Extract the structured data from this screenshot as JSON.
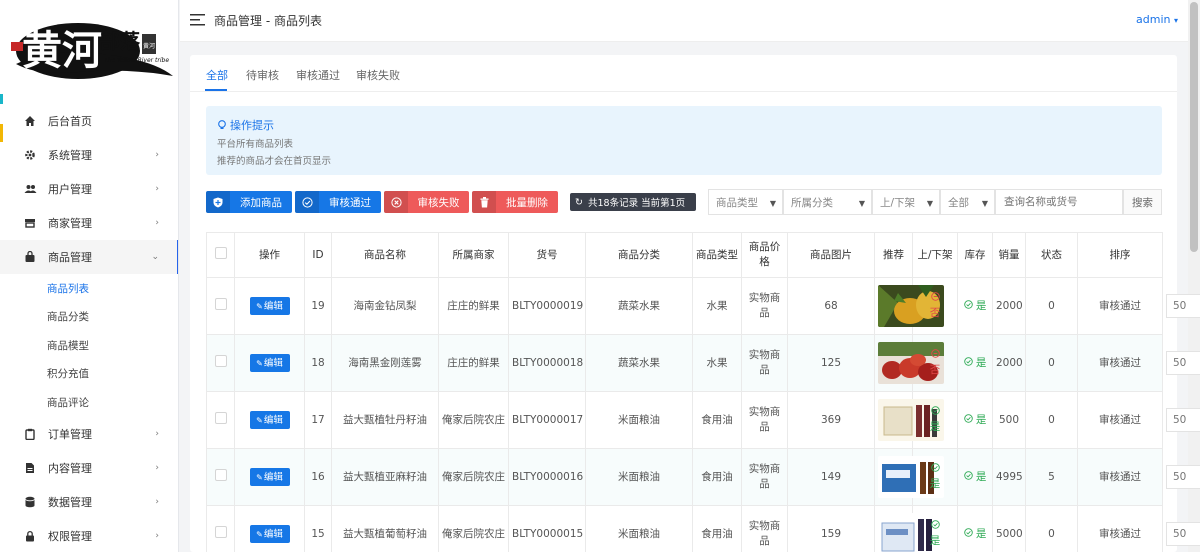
{
  "brand": {
    "logo_text": "黄河部落",
    "logo_sub": "The Yellow River tribe",
    "logo_seal": "黄河"
  },
  "header": {
    "breadcrumb": "商品管理 - 商品列表",
    "user": "admin"
  },
  "sidebar": {
    "items": [
      {
        "label": "后台首页",
        "icon": "home-icon"
      },
      {
        "label": "系统管理",
        "icon": "gear-icon"
      },
      {
        "label": "用户管理",
        "icon": "users-icon"
      },
      {
        "label": "商家管理",
        "icon": "store-icon"
      },
      {
        "label": "商品管理",
        "icon": "bag-icon"
      },
      {
        "label": "订单管理",
        "icon": "clipboard-icon"
      },
      {
        "label": "内容管理",
        "icon": "file-icon"
      },
      {
        "label": "数据管理",
        "icon": "database-icon"
      },
      {
        "label": "权限管理",
        "icon": "lock-icon"
      }
    ],
    "sub_items": [
      {
        "label": "商品列表"
      },
      {
        "label": "商品分类"
      },
      {
        "label": "商品模型"
      },
      {
        "label": "积分充值"
      },
      {
        "label": "商品评论"
      }
    ]
  },
  "tabs": [
    {
      "label": "全部"
    },
    {
      "label": "待审核"
    },
    {
      "label": "审核通过"
    },
    {
      "label": "审核失败"
    }
  ],
  "tip": {
    "title": "操作提示",
    "lines": [
      "平台所有商品列表",
      "推荐的商品才会在首页显示"
    ]
  },
  "toolbar": {
    "add": "添加商品",
    "approve": "审核通过",
    "reject": "审核失败",
    "batch_delete": "批量删除",
    "stat": "共18条记录 当前第1页",
    "filters": [
      "商品类型",
      "所属分类",
      "上/下架",
      "全部"
    ],
    "search_placeholder": "查询名称或货号",
    "search": "搜索"
  },
  "table": {
    "columns": [
      "操作",
      "ID",
      "商品名称",
      "所属商家",
      "货号",
      "商品分类",
      "商品类型",
      "商品价格",
      "商品图片",
      "推荐",
      "上/下架",
      "库存",
      "销量",
      "状态",
      "排序"
    ],
    "edit_label": "编辑",
    "rows": [
      {
        "id": "19",
        "name": "海南金钻凤梨",
        "merchant": "庄庄的鲜果",
        "sku": "BLTY0000019",
        "cat1": "蔬菜水果",
        "cat2": "水果",
        "type": "实物商品",
        "price": "68",
        "img": "pineapple",
        "recommend": "否",
        "shelf": "是",
        "stock": "2000",
        "sales": "0",
        "status": "审核通过",
        "sort": "50"
      },
      {
        "id": "18",
        "name": "海南黑金刚莲雾",
        "merchant": "庄庄的鲜果",
        "sku": "BLTY0000018",
        "cat1": "蔬菜水果",
        "cat2": "水果",
        "type": "实物商品",
        "price": "125",
        "img": "waxapple",
        "recommend": "否",
        "shelf": "是",
        "stock": "2000",
        "sales": "0",
        "status": "审核通过",
        "sort": "50"
      },
      {
        "id": "17",
        "name": "益大甄植牡丹籽油",
        "merchant": "俺家后院农庄",
        "sku": "BLTY0000017",
        "cat1": "米面粮油",
        "cat2": "食用油",
        "type": "实物商品",
        "price": "369",
        "img": "oil-box",
        "recommend": "是",
        "shelf": "是",
        "stock": "500",
        "sales": "0",
        "status": "审核通过",
        "sort": "50"
      },
      {
        "id": "16",
        "name": "益大甄植亚麻籽油",
        "merchant": "俺家后院农庄",
        "sku": "BLTY0000016",
        "cat1": "米面粮油",
        "cat2": "食用油",
        "type": "实物商品",
        "price": "149",
        "img": "oil-blue",
        "recommend": "是",
        "shelf": "是",
        "stock": "4995",
        "sales": "5",
        "status": "审核通过",
        "sort": "50"
      },
      {
        "id": "15",
        "name": "益大甄植葡萄籽油",
        "merchant": "俺家后院农庄",
        "sku": "BLTY0000015",
        "cat1": "米面粮油",
        "cat2": "食用油",
        "type": "实物商品",
        "price": "159",
        "img": "oil-grape",
        "recommend": "是",
        "shelf": "是",
        "stock": "5000",
        "sales": "0",
        "status": "审核通过",
        "sort": "50"
      }
    ]
  },
  "colors": {
    "primary": "#1677e6",
    "danger": "#ee5a5a",
    "success": "#2eaa55"
  }
}
